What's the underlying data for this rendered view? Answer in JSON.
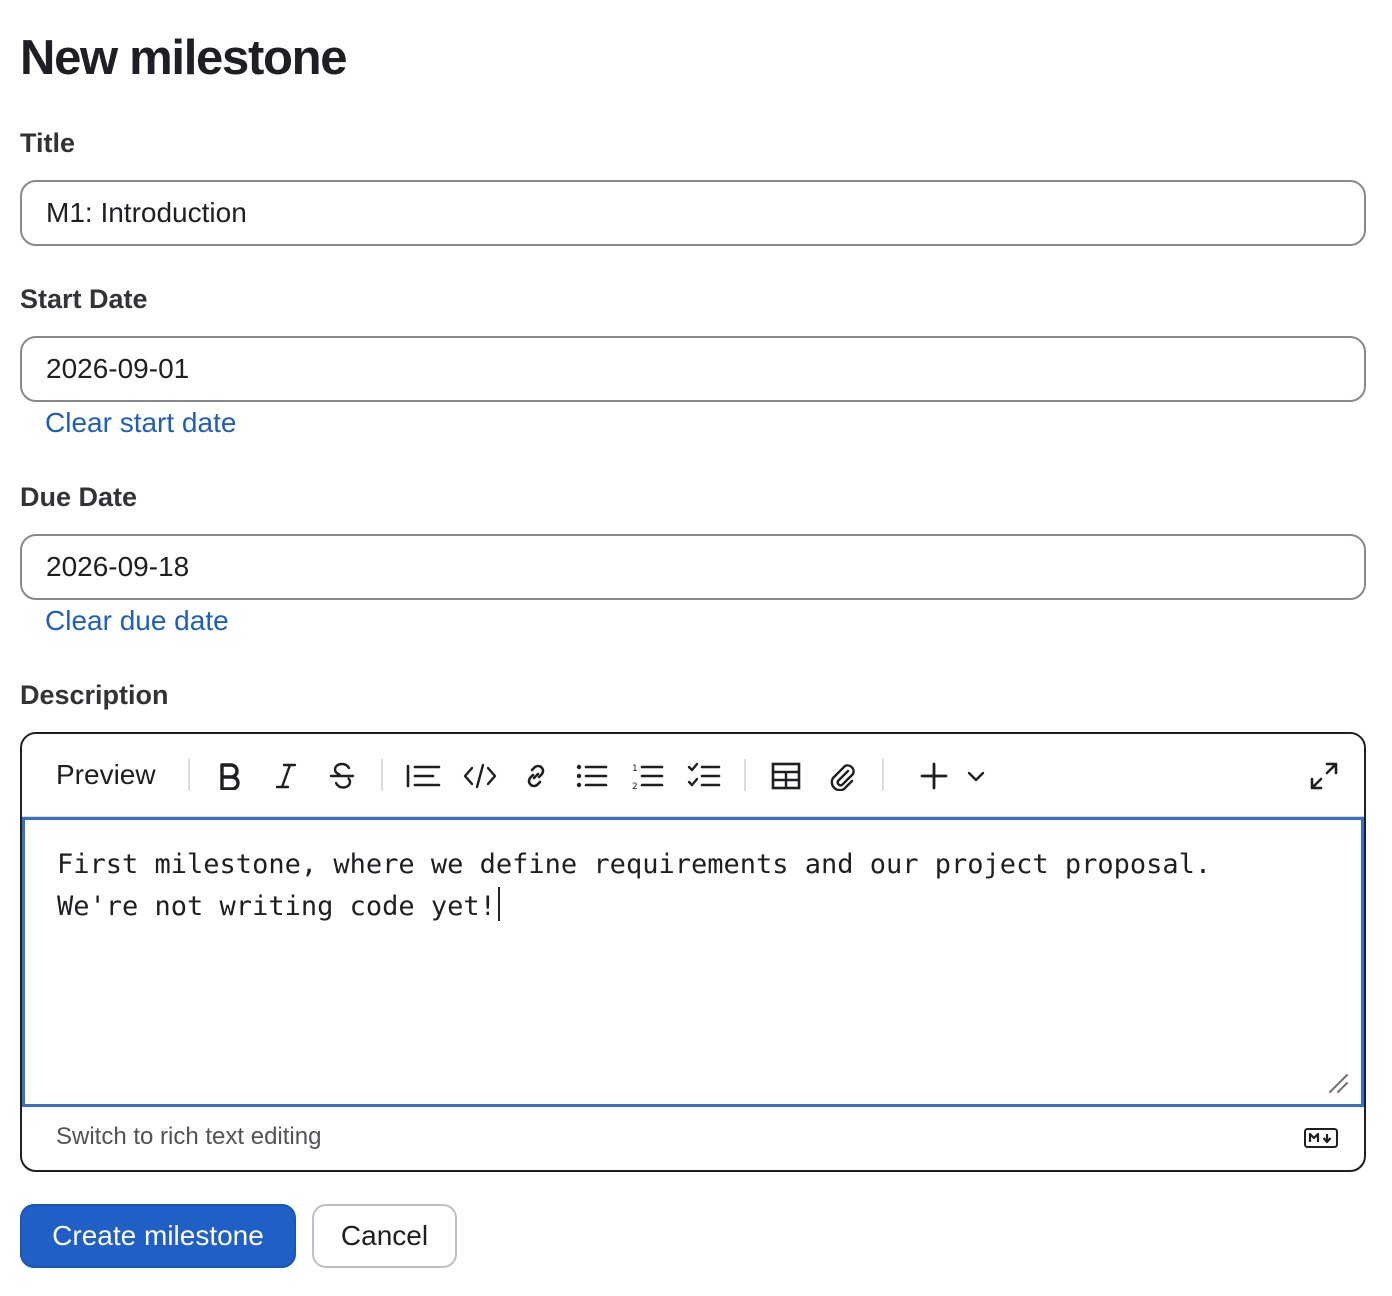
{
  "page": {
    "title": "New milestone"
  },
  "form": {
    "title": {
      "label": "Title",
      "value": "M1: Introduction"
    },
    "start_date": {
      "label": "Start Date",
      "value": "2026-09-01",
      "clear_label": "Clear start date"
    },
    "due_date": {
      "label": "Due Date",
      "value": "2026-09-18",
      "clear_label": "Clear due date"
    },
    "description": {
      "label": "Description",
      "toolbar": {
        "preview_label": "Preview",
        "buttons": [
          "bold-icon",
          "italic-icon",
          "strikethrough-icon",
          "quote-icon",
          "code-icon",
          "link-icon",
          "bullet-list-icon",
          "numbered-list-icon",
          "task-list-icon",
          "table-icon",
          "attach-file-icon",
          "plus-icon",
          "chevron-down-icon",
          "fullscreen-icon"
        ]
      },
      "value": "First milestone, where we define requirements and our project proposal.\nWe're not writing code yet!",
      "switch_label": "Switch to rich text editing",
      "markdown_icon": "markdown-icon"
    }
  },
  "actions": {
    "create_label": "Create milestone",
    "cancel_label": "Cancel"
  },
  "colors": {
    "primary": "#1f5fc6",
    "link": "#1f5fb8",
    "focus_border": "#3a6fc6"
  }
}
